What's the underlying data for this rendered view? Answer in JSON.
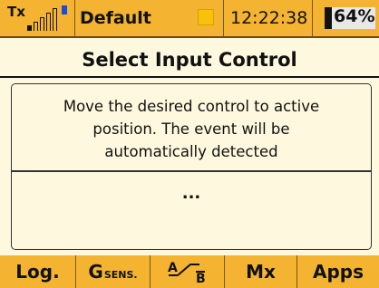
{
  "status": {
    "tx_label": "Tx",
    "model_name": "Default",
    "time": "12:22:38",
    "battery": "64%",
    "battery_level": 0.64
  },
  "page_title": "Select Input Control",
  "message": "Move the desired control to active position. The event will be automatically detected",
  "detected_value": "...",
  "footer": {
    "log": "Log.",
    "gsens_g": "G",
    "gsens_sub": "SENS.",
    "ab_icon": "a-to-b-switch-icon",
    "mx": "Mx",
    "apps": "Apps"
  },
  "colors": {
    "accent": "#f4b331",
    "background": "#fef8df",
    "tx_indicator": "#1b4ed8"
  }
}
